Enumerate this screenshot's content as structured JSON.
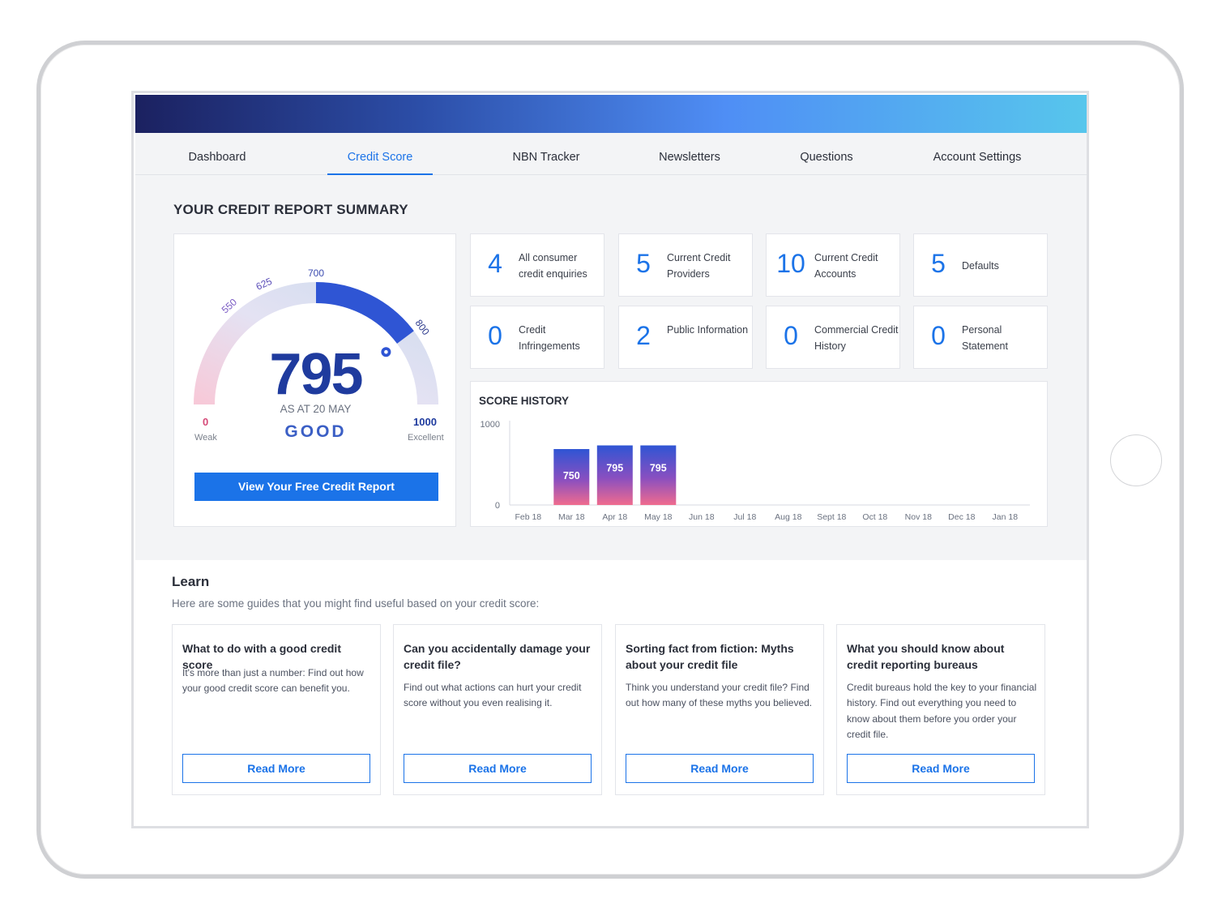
{
  "nav": {
    "items": [
      "Dashboard",
      "Credit Score",
      "NBN Tracker",
      "Newsletters",
      "Questions",
      "Account Settings"
    ],
    "active": "Credit Score"
  },
  "summary": {
    "title": "YOUR CREDIT REPORT SUMMARY",
    "gauge": {
      "score": "795",
      "as_at": "AS AT 20 MAY",
      "rating": "GOOD",
      "min_value": "0",
      "min_label": "Weak",
      "max_value": "1000",
      "max_label": "Excellent",
      "tick_labels": [
        "550",
        "625",
        "700",
        "800"
      ],
      "score_fraction": 0.795,
      "cta_label": "View Your Free Credit Report"
    },
    "stats": [
      {
        "value": "4",
        "label": "All consumer credit enquiries"
      },
      {
        "value": "5",
        "label": "Current Credit Providers"
      },
      {
        "value": "10",
        "label": "Current Credit Accounts"
      },
      {
        "value": "5",
        "label": "Defaults"
      },
      {
        "value": "0",
        "label": "Credit Infringements"
      },
      {
        "value": "2",
        "label": "Public Information"
      },
      {
        "value": "0",
        "label": "Commercial Credit History"
      },
      {
        "value": "0",
        "label": "Personal Statement"
      }
    ]
  },
  "chart_data": {
    "type": "bar",
    "title": "SCORE HISTORY",
    "categories": [
      "Feb 18",
      "Mar 18",
      "Apr 18",
      "May 18",
      "Jun 18",
      "Jul 18",
      "Aug 18",
      "Sept 18",
      "Oct 18",
      "Nov 18",
      "Dec 18",
      "Jan 18"
    ],
    "values": [
      null,
      750,
      795,
      795,
      null,
      null,
      null,
      null,
      null,
      null,
      null,
      null
    ],
    "ylim": [
      0,
      1000
    ],
    "yticks": [
      "1000",
      "0"
    ],
    "grid": false,
    "colors": {
      "top": "#2f55d4",
      "bottom": "#f06b8e"
    }
  },
  "learn": {
    "title": "Learn",
    "subtitle": "Here are some guides that you might find useful based on your credit score:",
    "guides": [
      {
        "title": "What to do with a good credit score",
        "body": "It's more than just a number: Find out how your good credit score can benefit you.",
        "button": "Read More"
      },
      {
        "title": "Can you accidentally damage your credit file?",
        "body": "Find out what actions can hurt your credit score without you even realising it.",
        "button": "Read More"
      },
      {
        "title": "Sorting fact from fiction: Myths about your credit file",
        "body": "Think you understand your credit file? Find out how many of these myths you believed.",
        "button": "Read More"
      },
      {
        "title": "What you should know about credit reporting bureaus",
        "body": "Credit bureaus hold the key to your financial history. Find out everything you need to know about them before you order your credit file.",
        "button": "Read More"
      }
    ]
  },
  "colors": {
    "accent": "#1b73e8",
    "score_blue": "#1f3b9e",
    "weak_pink": "#d64a78"
  }
}
